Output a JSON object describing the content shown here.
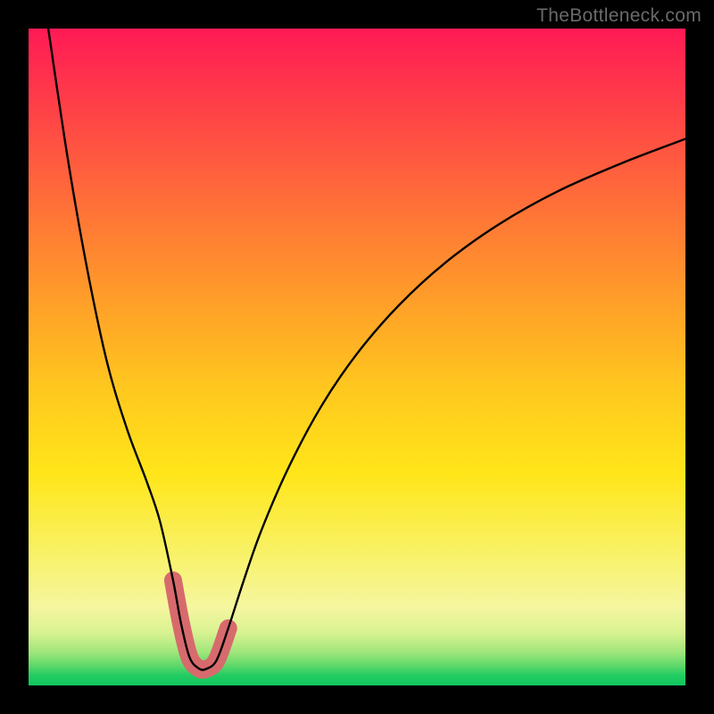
{
  "watermark": "TheBottleneck.com",
  "chart_data": {
    "type": "line",
    "title": "",
    "xlabel": "",
    "ylabel": "",
    "xlim": [
      0,
      100
    ],
    "ylim": [
      0,
      100
    ],
    "series": [
      {
        "name": "curve",
        "x": [
          3,
          6,
          9,
          12,
          15,
          18,
          20,
          22,
          23.2,
          24.5,
          25.9,
          27.0,
          28.6,
          30.4,
          32.7,
          35.4,
          39.5,
          44.5,
          50.0,
          56.4,
          63.5,
          71.6,
          80.5,
          90.3,
          100.0
        ],
        "values": [
          100,
          80,
          63,
          49,
          39,
          31,
          25,
          16,
          9.5,
          4.3,
          2.6,
          2.5,
          3.8,
          8.7,
          15.8,
          23.5,
          33.0,
          42.4,
          50.5,
          57.9,
          64.4,
          70.2,
          75.2,
          79.5,
          83.2
        ]
      }
    ],
    "highlight_range_x": [
      22.0,
      31.5
    ],
    "highlight_color": "#d76a6d",
    "background_gradient": {
      "top": "#ff1a55",
      "bottom": "#10c760"
    }
  }
}
